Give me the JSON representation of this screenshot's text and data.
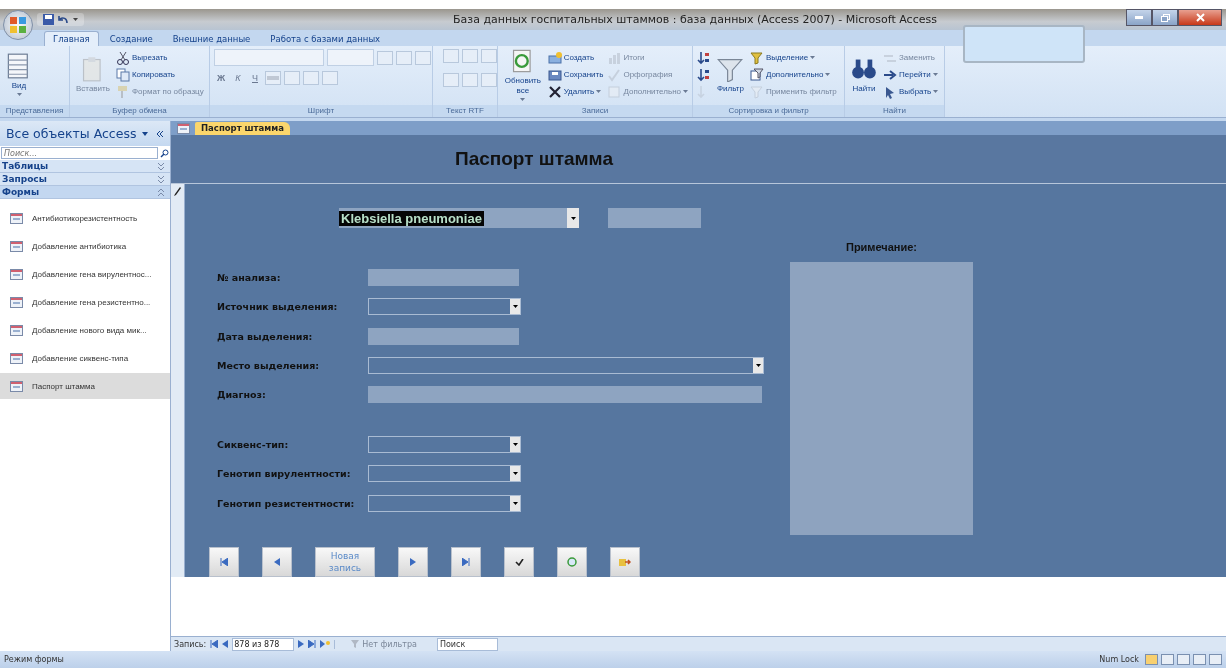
{
  "window": {
    "title": "База данных госпитальных штаммов : база данных (Access 2007) - Microsoft Access"
  },
  "ribbon": {
    "tabs": [
      {
        "label": "Главная",
        "selected": true
      },
      {
        "label": "Создание",
        "selected": false
      },
      {
        "label": "Внешние данные",
        "selected": false
      },
      {
        "label": "Работа с базами данных",
        "selected": false
      }
    ],
    "groups": [
      {
        "kind": "commands",
        "label": "Представления",
        "items": [
          {
            "label": "Вид",
            "kind": "large",
            "disabled": false,
            "dropdown": true
          }
        ]
      },
      {
        "kind": "commands",
        "label": "Буфер обмена",
        "items": [
          {
            "label": "Вставить",
            "kind": "large",
            "disabled": true,
            "dropdown": false
          },
          {
            "label": "Вырезать",
            "kind": "small",
            "disabled": false,
            "dropdown": false
          },
          {
            "label": "Копировать",
            "kind": "small",
            "disabled": false,
            "dropdown": false
          },
          {
            "label": "Формат по образцу",
            "kind": "small",
            "disabled": true,
            "dropdown": false
          }
        ]
      },
      {
        "kind": "font",
        "label": "Шрифт",
        "buttons": [
          "Ж",
          "К",
          "Ч"
        ]
      },
      {
        "kind": "rtf",
        "label": "Текст RTF"
      },
      {
        "kind": "commands",
        "label": "Записи",
        "items": [
          {
            "label": "Обновить все",
            "kind": "large",
            "disabled": false,
            "dropdown": true
          },
          {
            "label": "Создать",
            "kind": "small",
            "disabled": false,
            "dropdown": false
          },
          {
            "label": "Сохранить",
            "kind": "small",
            "disabled": false,
            "dropdown": false
          },
          {
            "label": "Удалить",
            "kind": "small",
            "disabled": false,
            "dropdown": true
          },
          {
            "label": "Итоги",
            "kind": "small",
            "disabled": true,
            "dropdown": false
          },
          {
            "label": "Орфография",
            "kind": "small",
            "disabled": true,
            "dropdown": false
          },
          {
            "label": "Дополнительно",
            "kind": "small",
            "disabled": true,
            "dropdown": true
          }
        ]
      },
      {
        "kind": "commands",
        "label": "Сортировка и фильтр",
        "items": [
          {
            "kind": "icon",
            "disabled": false
          },
          {
            "kind": "icon",
            "disabled": false
          },
          {
            "kind": "icon",
            "disabled": true
          },
          {
            "label": "Фильтр",
            "kind": "large",
            "disabled": false,
            "dropdown": false
          },
          {
            "label": "Выделение",
            "kind": "small",
            "disabled": false,
            "dropdown": true
          },
          {
            "label": "Дополнительно",
            "kind": "small",
            "disabled": false,
            "dropdown": true
          },
          {
            "label": "Применить фильтр",
            "kind": "small",
            "disabled": true,
            "dropdown": false
          }
        ]
      },
      {
        "kind": "commands",
        "label": "Найти",
        "items": [
          {
            "label": "Найти",
            "kind": "large",
            "disabled": false,
            "dropdown": false
          },
          {
            "label": "Заменить",
            "kind": "small",
            "disabled": true,
            "dropdown": false
          },
          {
            "label": "Перейти",
            "kind": "small",
            "disabled": false,
            "dropdown": true
          },
          {
            "label": "Выбрать",
            "kind": "small",
            "disabled": false,
            "dropdown": true
          }
        ]
      }
    ]
  },
  "nav": {
    "title": "Все объекты Access",
    "search_placeholder": "Поиск...",
    "groups": [
      {
        "label": "Таблицы",
        "expanded": false
      },
      {
        "label": "Запросы",
        "expanded": false
      },
      {
        "label": "Формы",
        "expanded": true,
        "items": [
          {
            "label": "Антибиотикорезистентность",
            "selected": false
          },
          {
            "label": "Добавление антибиотика",
            "selected": false
          },
          {
            "label": "Добавление гена вирулентнос...",
            "selected": false
          },
          {
            "label": "Добавление гена резистентно...",
            "selected": false
          },
          {
            "label": "Добавление нового вида мик...",
            "selected": false
          },
          {
            "label": "Добавление сиквенс-типа",
            "selected": false
          },
          {
            "label": "Паспорт штамма",
            "selected": true
          }
        ]
      }
    ]
  },
  "document": {
    "tabs": [
      {
        "label": "Паспорт штамма",
        "selected": true
      }
    ],
    "form": {
      "title": "Паспорт штамма",
      "species": {
        "value": "Klebsiella pneumoniae",
        "selected": true
      },
      "fields": [
        {
          "label": "№ анализа:",
          "kind": "text"
        },
        {
          "label": "Источник выделения:",
          "kind": "combo"
        },
        {
          "label": "Дата выделения:",
          "kind": "text"
        },
        {
          "label": "Место выделения:",
          "kind": "wide_combo"
        },
        {
          "label": "Диагноз:",
          "kind": "wide_text"
        }
      ],
      "typing_fields": [
        {
          "label": "Сиквенс-тип:",
          "kind": "combo"
        },
        {
          "label": "Генотип вирулентности:",
          "kind": "combo"
        },
        {
          "label": "Генотип резистентности:",
          "kind": "combo"
        }
      ],
      "note_label": "Примечание:",
      "buttons": [
        {
          "kind": "first"
        },
        {
          "kind": "previous"
        },
        {
          "kind": "text",
          "label": "Новая запись"
        },
        {
          "kind": "next"
        },
        {
          "kind": "last"
        },
        {
          "kind": "check"
        },
        {
          "kind": "refresh"
        },
        {
          "kind": "exit"
        }
      ]
    },
    "record_nav": {
      "label": "Запись:",
      "position": "878 из 878",
      "filter": {
        "label": "Нет фильтра",
        "disabled": true
      },
      "search_placeholder": "Поиск"
    }
  },
  "status_bar": {
    "mode": "Режим формы",
    "indicators": [
      "Num Lock"
    ]
  }
}
